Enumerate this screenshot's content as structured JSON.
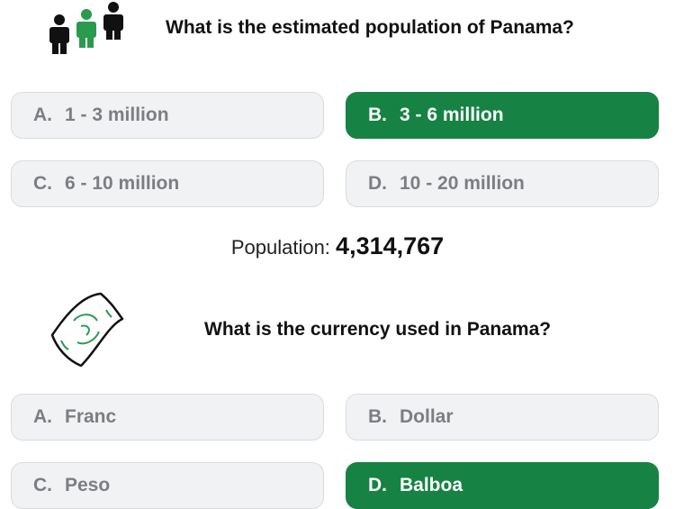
{
  "quiz": [
    {
      "icon": "people-icon",
      "question": "What is the estimated population of Panama?",
      "options": [
        {
          "letter": "A.",
          "text": "1 - 3 million",
          "correct": false
        },
        {
          "letter": "B.",
          "text": "3 - 6 million",
          "correct": true
        },
        {
          "letter": "C.",
          "text": "6 - 10 million",
          "correct": false
        },
        {
          "letter": "D.",
          "text": "10 - 20 million",
          "correct": false
        }
      ]
    },
    {
      "icon": "money-bill-icon",
      "question": "What is the currency used in Panama?",
      "options": [
        {
          "letter": "A.",
          "text": "Franc",
          "correct": false
        },
        {
          "letter": "B.",
          "text": "Dollar",
          "correct": false
        },
        {
          "letter": "C.",
          "text": "Peso",
          "correct": false
        },
        {
          "letter": "D.",
          "text": "Balboa",
          "correct": true
        }
      ]
    }
  ],
  "population": {
    "label": "Population:",
    "value": "4,314,767"
  },
  "colors": {
    "correct": "#168244",
    "option_bg": "#f1f2f4",
    "option_text": "#7b7e82",
    "icon_green": "#2a9a4d"
  }
}
